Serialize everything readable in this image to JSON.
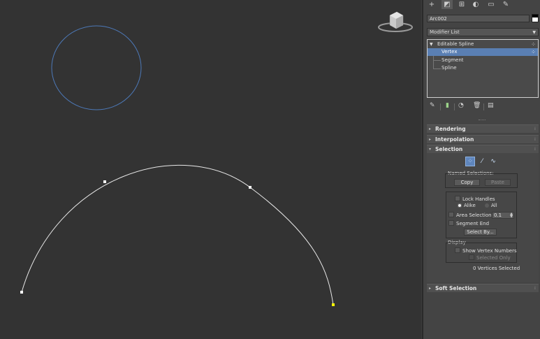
{
  "command_panel": {
    "tabs": [
      {
        "name": "create-tab",
        "glyph": "+"
      },
      {
        "name": "modify-tab",
        "glyph": "◩"
      },
      {
        "name": "hierarchy-tab",
        "glyph": "⊞"
      },
      {
        "name": "motion-tab",
        "glyph": "◐"
      },
      {
        "name": "display-tab",
        "glyph": "▭"
      },
      {
        "name": "utilities-tab",
        "glyph": "✎"
      }
    ],
    "object_name": "Arc002",
    "modifier_list": "Modifier List",
    "stack": {
      "base": "Editable Spline",
      "items": [
        "Vertex",
        "Segment",
        "Spline"
      ],
      "selected": "Vertex"
    },
    "rollouts": {
      "rendering": "Rendering",
      "interpolation": "Interpolation",
      "selection": "Selection",
      "soft_selection": "Soft Selection"
    },
    "selection": {
      "named_selections": "Named Selections:",
      "copy": "Copy",
      "paste": "Paste",
      "lock_handles": "Lock Handles",
      "alike": "Alike",
      "all": "All",
      "area_selection": "Area Selection:",
      "area_value": "0.1",
      "segment_end": "Segment End",
      "select_by": "Select By...",
      "display": "Display",
      "show_vertex_numbers": "Show Vertex Numbers",
      "selected_only": "Selected Only",
      "status": "0 Vertices Selected"
    }
  },
  "colors": {
    "viewport_bg": "#333333",
    "circle": "#4d79b8",
    "arc": "#e8e8e8",
    "vertex": "#ffffff",
    "selected_vertex": "#ffff00",
    "selection_highlight": "#5a7fb3"
  }
}
